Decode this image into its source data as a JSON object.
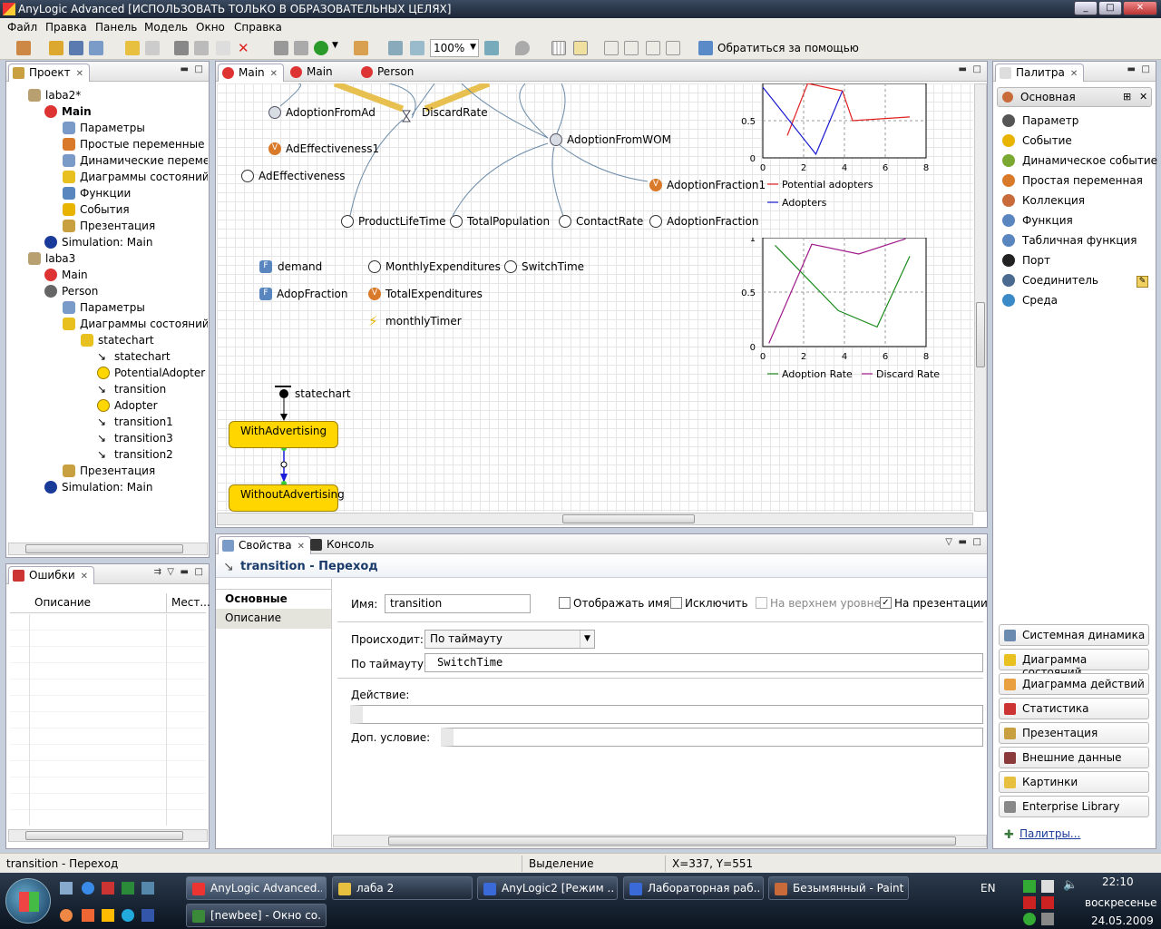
{
  "window": {
    "title": "AnyLogic Advanced [ИСПОЛЬЗОВАТЬ ТОЛЬКО В ОБРАЗОВАТЕЛЬНЫХ ЦЕЛЯХ]"
  },
  "menu": [
    "Файл",
    "Правка",
    "Панель",
    "Модель",
    "Окно",
    "Справка"
  ],
  "toolbar": {
    "zoom": "100%",
    "help_label": "Обратиться за помощью"
  },
  "project_panel": {
    "title": "Проект",
    "items": [
      {
        "label": "laba2*",
        "icon": "model-icon"
      },
      {
        "label": "Main",
        "icon": "agent-icon"
      },
      {
        "label": "Параметры",
        "icon": "parameters-icon"
      },
      {
        "label": "Простые переменные",
        "icon": "variables-icon"
      },
      {
        "label": "Динамические переменн",
        "icon": "dynamic-variables-icon"
      },
      {
        "label": "Диаграммы состояний",
        "icon": "statecharts-icon"
      },
      {
        "label": "Функции",
        "icon": "functions-icon"
      },
      {
        "label": "События",
        "icon": "events-icon"
      },
      {
        "label": "Презентация",
        "icon": "presentation-icon"
      },
      {
        "label": "Simulation: Main",
        "icon": "simulation-icon"
      },
      {
        "label": "laba3",
        "icon": "model-icon"
      },
      {
        "label": "Main",
        "icon": "agent-icon"
      },
      {
        "label": "Person",
        "icon": "person-icon"
      },
      {
        "label": "Параметры",
        "icon": "parameters-icon"
      },
      {
        "label": "Диаграммы состояний",
        "icon": "statecharts-icon"
      },
      {
        "label": "statechart",
        "icon": "statechart-icon"
      },
      {
        "label": "statechart",
        "icon": "entry-point-icon"
      },
      {
        "label": "PotentialAdopter",
        "icon": "state-icon"
      },
      {
        "label": "transition",
        "icon": "transition-icon"
      },
      {
        "label": "Adopter",
        "icon": "state-icon"
      },
      {
        "label": "transition1",
        "icon": "transition-icon"
      },
      {
        "label": "transition3",
        "icon": "transition-icon"
      },
      {
        "label": "transition2",
        "icon": "transition-icon"
      },
      {
        "label": "Презентация",
        "icon": "presentation-icon"
      },
      {
        "label": "Simulation: Main",
        "icon": "simulation-icon"
      }
    ]
  },
  "errors_panel": {
    "title": "Ошибки",
    "col_description": "Описание",
    "col_location": "Мест..."
  },
  "editor_tabs": [
    {
      "label": "Main",
      "active": true
    },
    {
      "label": "Main",
      "active": false
    },
    {
      "label": "Person",
      "active": false
    }
  ],
  "diagram": {
    "nodes": {
      "adoption_from_ad": "AdoptionFromAd",
      "discard_rate": "DiscardRate",
      "adoption_from_wom": "AdoptionFromWOM",
      "ad_effectiveness1": "AdEffectiveness1",
      "ad_effectiveness": "AdEffectiveness",
      "adoption_fraction1": "AdoptionFraction1",
      "product_life_time": "ProductLifeTime",
      "total_population": "TotalPopulation",
      "contact_rate": "ContactRate",
      "adoption_fraction": "AdoptionFraction",
      "demand": "demand",
      "monthly_expenditures": "MonthlyExpenditures",
      "switch_time": "SwitchTime",
      "adop_fraction": "AdopFraction",
      "total_expenditures": "TotalExpenditures",
      "monthly_timer": "monthlyTimer",
      "statechart": "statechart",
      "state_with": "WithAdvertising",
      "state_without": "WithoutAdvertising"
    },
    "icon_letters": {
      "variable": "V",
      "function": "F"
    }
  },
  "chart_data": [
    {
      "type": "line",
      "xlim": [
        0,
        8
      ],
      "ylim": [
        0,
        1
      ],
      "x_ticks": [
        "0",
        "2",
        "4",
        "6",
        "8"
      ],
      "y_ticks": [
        "0",
        "0.5"
      ],
      "grid": true,
      "legend_position": "right",
      "series": [
        {
          "name": "Potential adopters",
          "color": "#e02020",
          "x": [
            1.2,
            2.2,
            3.9,
            4.4,
            7.2
          ],
          "y": [
            0.3,
            1.0,
            0.9,
            0.5,
            0.55
          ]
        },
        {
          "name": "Adopters",
          "color": "#1a1ad0",
          "x": [
            0,
            2.6,
            3.9
          ],
          "y": [
            0.95,
            0.05,
            0.9
          ]
        }
      ]
    },
    {
      "type": "line",
      "xlim": [
        0,
        8
      ],
      "ylim": [
        0,
        1
      ],
      "x_ticks": [
        "0",
        "2",
        "4",
        "6",
        "8"
      ],
      "y_ticks": [
        "0",
        "0.5",
        "1"
      ],
      "grid": true,
      "legend_position": "bottom",
      "series": [
        {
          "name": "Adoption Rate",
          "color": "#1a8a1a",
          "x": [
            0.6,
            3.7,
            5.6,
            7.2
          ],
          "y": [
            0.93,
            0.33,
            0.18,
            0.83
          ]
        },
        {
          "name": "Discard Rate",
          "color": "#a01a8a",
          "x": [
            0.3,
            2.4,
            4.7,
            7.0
          ],
          "y": [
            0.03,
            0.94,
            0.85,
            0.99
          ]
        }
      ]
    }
  ],
  "properties_panel": {
    "tab_properties": "Свойства",
    "tab_console": "Консоль",
    "header": "transition - Переход",
    "side_tabs": [
      "Основные",
      "Описание"
    ],
    "name_label": "Имя:",
    "name_value": "transition",
    "cb_show_name": "Отображать имя",
    "cb_exclude": "Исключить",
    "cb_top_level": "На верхнем уровне",
    "cb_on_presentation": "На презентации",
    "occurs_label": "Происходит:",
    "occurs_value": "По таймауту",
    "timeout_label": "По таймауту:",
    "timeout_value": "SwitchTime",
    "action_label": "Действие:",
    "action_value": "",
    "guard_label": "Доп. условие:",
    "guard_value": ""
  },
  "palette": {
    "title": "Палитра",
    "section": "Основная",
    "items": [
      {
        "label": "Параметр",
        "color": "#555"
      },
      {
        "label": "Событие",
        "color": "#e8b400"
      },
      {
        "label": "Динамическое событие",
        "color": "#7aa830"
      },
      {
        "label": "Простая переменная",
        "color": "#d87a2a"
      },
      {
        "label": "Коллекция",
        "color": "#c86a3a"
      },
      {
        "label": "Функция",
        "color": "#5a86c0"
      },
      {
        "label": "Табличная функция",
        "color": "#5a86c0"
      },
      {
        "label": "Порт",
        "color": "#222"
      },
      {
        "label": "Соединитель",
        "color": "#4a6a90"
      },
      {
        "label": "Среда",
        "color": "#3a8ac8"
      }
    ],
    "groups": [
      "Системная динамика",
      "Диаграмма состояний",
      "Диаграмма действий",
      "Статистика",
      "Презентация",
      "Внешние данные",
      "Картинки",
      "Enterprise Library"
    ],
    "more_link": "Палитры..."
  },
  "statusbar": {
    "left": "transition - Переход",
    "mode": "Выделение",
    "coords": "X=337, Y=551"
  },
  "taskbar": {
    "buttons": [
      {
        "label": "AnyLogic Advanced...",
        "active": true
      },
      {
        "label": "лаба 2",
        "active": false
      },
      {
        "label": "AnyLogic2 [Режим ...",
        "active": false
      },
      {
        "label": "Лабораторная раб...",
        "active": false
      },
      {
        "label": "Безымянный - Paint",
        "active": false
      },
      {
        "label": "[newbee] - Окно со...",
        "active": false
      }
    ],
    "lang": "EN",
    "time": "22:10",
    "day": "воскресенье",
    "date": "24.05.2009"
  }
}
